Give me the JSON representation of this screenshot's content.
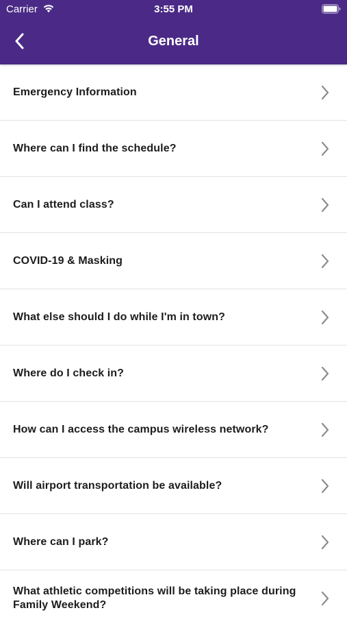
{
  "status_bar": {
    "carrier": "Carrier",
    "time": "3:55 PM"
  },
  "nav": {
    "title": "General",
    "back_icon": "chevron-left-icon"
  },
  "colors": {
    "header": "#4a2a86",
    "chevron": "#8c8c8c",
    "divider": "#e3e3e3"
  },
  "items": [
    {
      "label": "Emergency Information"
    },
    {
      "label": "Where can I find the schedule?"
    },
    {
      "label": "Can I attend class?"
    },
    {
      "label": "COVID-19 & Masking"
    },
    {
      "label": "What else should I do while I'm in town?"
    },
    {
      "label": "Where do I check in?"
    },
    {
      "label": "How can I access the campus wireless network?"
    },
    {
      "label": "Will airport transportation be available?"
    },
    {
      "label": "Where can I park?"
    },
    {
      "label": "What athletic competitions will be taking place during Family Weekend?"
    }
  ]
}
